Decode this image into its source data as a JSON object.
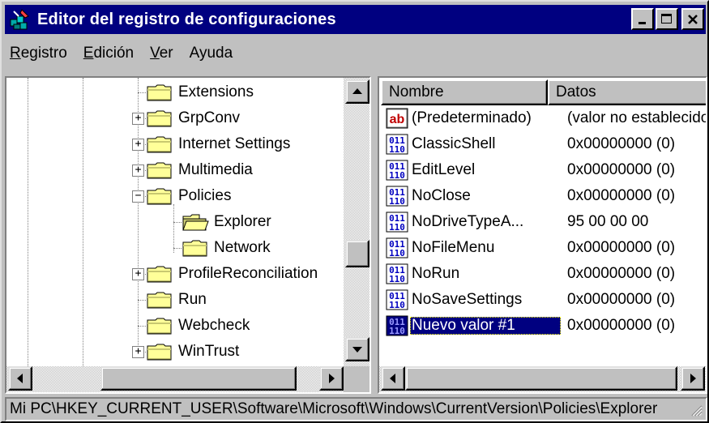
{
  "window": {
    "title": "Editor del registro de configuraciones"
  },
  "menu": [
    {
      "mnemonic": "R",
      "rest": "egistro"
    },
    {
      "mnemonic": "E",
      "rest": "dición"
    },
    {
      "mnemonic": "V",
      "rest": "er"
    },
    {
      "mnemonic": "",
      "rest": "Ayuda"
    }
  ],
  "tree": {
    "items": [
      {
        "label": "Extensions",
        "expander": "",
        "open": false
      },
      {
        "label": "GrpConv",
        "expander": "+",
        "open": false
      },
      {
        "label": "Internet Settings",
        "expander": "+",
        "open": false
      },
      {
        "label": "Multimedia",
        "expander": "+",
        "open": false
      },
      {
        "label": "Policies",
        "expander": "−",
        "open": false
      },
      {
        "label": "Explorer",
        "expander": "",
        "open": true
      },
      {
        "label": "Network",
        "expander": "",
        "open": false
      },
      {
        "label": "ProfileReconciliation",
        "expander": "+",
        "open": false
      },
      {
        "label": "Run",
        "expander": "",
        "open": false
      },
      {
        "label": "Webcheck",
        "expander": "",
        "open": false
      },
      {
        "label": "WinTrust",
        "expander": "+",
        "open": false
      }
    ]
  },
  "list": {
    "columns": [
      "Nombre",
      "Datos"
    ],
    "rows": [
      {
        "type": "string",
        "name": "(Predeterminado)",
        "data": "(valor no establecido)"
      },
      {
        "type": "binary",
        "name": "ClassicShell",
        "data": "0x00000000 (0)"
      },
      {
        "type": "binary",
        "name": "EditLevel",
        "data": "0x00000000 (0)"
      },
      {
        "type": "binary",
        "name": "NoClose",
        "data": "0x00000000 (0)"
      },
      {
        "type": "binary",
        "name": "NoDriveTypeA...",
        "data": "95 00 00 00"
      },
      {
        "type": "binary",
        "name": "NoFileMenu",
        "data": "0x00000000 (0)"
      },
      {
        "type": "binary",
        "name": "NoRun",
        "data": "0x00000000 (0)"
      },
      {
        "type": "binary",
        "name": "NoSaveSettings",
        "data": "0x00000000 (0)"
      },
      {
        "type": "binary",
        "name": "Nuevo valor #1",
        "data": "0x00000000 (0)",
        "selected": true
      }
    ]
  },
  "status": {
    "path": "Mi PC\\HKEY_CURRENT_USER\\Software\\Microsoft\\Windows\\CurrentVersion\\Policies\\Explorer"
  },
  "colors": {
    "titlebar": "#000080",
    "face": "#c0c0c0",
    "selection": "#000080",
    "folder": "#ffff99"
  }
}
